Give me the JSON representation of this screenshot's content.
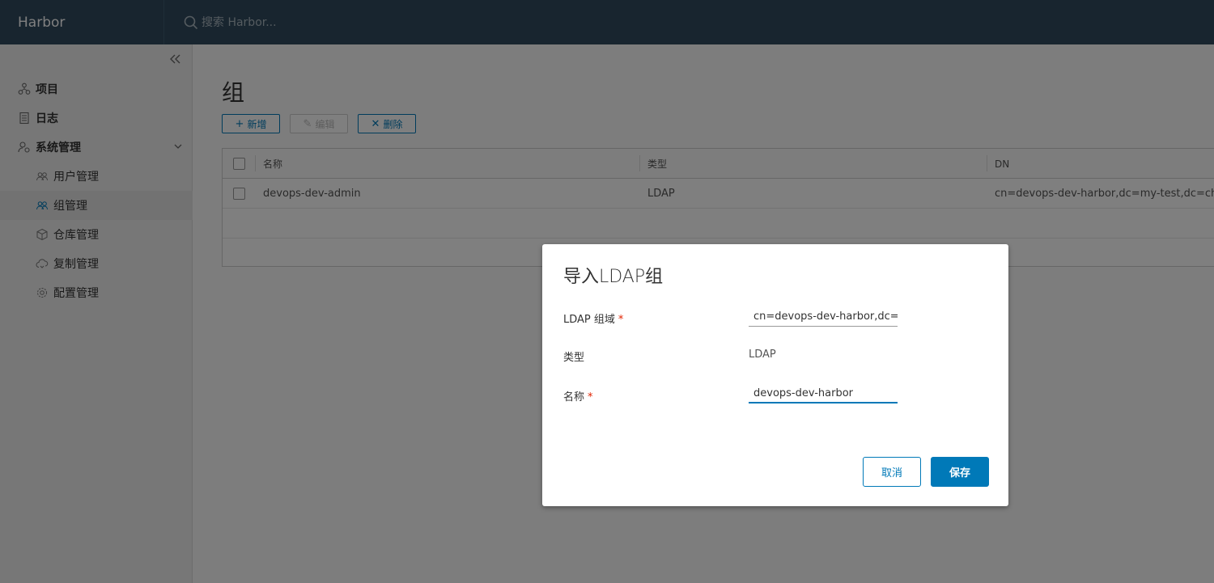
{
  "header": {
    "brand": "Harbor",
    "search_placeholder": "搜索 Harbor..."
  },
  "sidebar": {
    "items": [
      {
        "label": "项目",
        "icon": "projects-icon"
      },
      {
        "label": "日志",
        "icon": "logs-icon"
      },
      {
        "label": "系统管理",
        "icon": "admin-icon"
      },
      {
        "label": "用户管理",
        "icon": "users-icon"
      },
      {
        "label": "组管理",
        "icon": "groups-icon"
      },
      {
        "label": "仓库管理",
        "icon": "registry-icon"
      },
      {
        "label": "复制管理",
        "icon": "replication-icon"
      },
      {
        "label": "配置管理",
        "icon": "configuration-icon"
      }
    ]
  },
  "main": {
    "title": "组",
    "toolbar": {
      "add_label": "新增",
      "edit_label": "编辑",
      "delete_label": "删除"
    },
    "grid": {
      "columns": [
        "名称",
        "类型",
        "DN"
      ],
      "rows": [
        {
          "name": "devops-dev-admin",
          "type": "LDAP",
          "dn": "cn=devops-dev-harbor,dc=my-test,dc=china"
        }
      ]
    }
  },
  "modal": {
    "title": "导入LDAP组",
    "fields": {
      "ldap_dn_label": "LDAP 组域",
      "ldap_dn_value": "cn=devops-dev-harbor,dc=my-test,dc=china",
      "type_label": "类型",
      "type_value": "LDAP",
      "name_label": "名称",
      "name_value": "devops-dev-harbor",
      "required_mark": "*"
    },
    "cancel_label": "取消",
    "save_label": "保存"
  },
  "colors": {
    "header_bg": "#314b5f",
    "accent": "#0079b8",
    "required": "#e12200"
  }
}
